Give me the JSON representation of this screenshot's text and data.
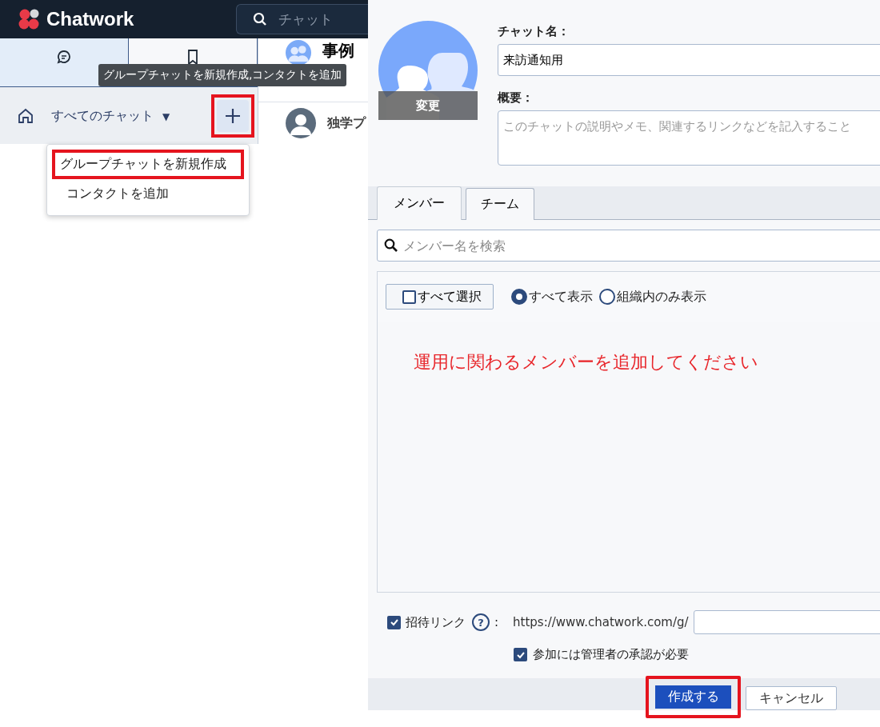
{
  "app_header": {
    "logo": "Chatwork",
    "search_placeholder": "チャット"
  },
  "sidebar": {
    "tabs": [
      {
        "kind": "chat",
        "selected": true
      },
      {
        "kind": "bookmark",
        "selected": false
      }
    ],
    "filter": {
      "label": "すべてのチャット",
      "caret": "▼"
    },
    "add_button": {
      "annotated": true
    }
  },
  "tooltip": "グループチャットを新規作成,コンタクトを追加",
  "add_menu": [
    {
      "label": "グループチャットを新規作成",
      "annotated": true
    },
    {
      "label": "コンタクトを追加",
      "annotated": false
    }
  ],
  "room_header": {
    "title": "事例"
  },
  "room_row": {
    "name": "独学プ"
  },
  "dialog": {
    "avatar_button": "変更",
    "name_label": "チャット名：",
    "name_value": "来訪通知用",
    "summary_label": "概要：",
    "summary_placeholder": "このチャットの説明やメモ、関連するリンクなどを記入すること",
    "tabs": [
      {
        "label": "メンバー",
        "selected": true
      },
      {
        "label": "チーム",
        "selected": false
      }
    ],
    "member_search_placeholder": "メンバー名を検索",
    "select_all": {
      "label": "すべて選択",
      "checked": false
    },
    "filters": [
      {
        "label": "すべて表示",
        "selected": true
      },
      {
        "label": "組織内のみ表示",
        "selected": false
      }
    ],
    "annotation": "運用に関わるメンバーを追加してください",
    "invite_link": {
      "label": "招待リンク",
      "checked": true,
      "help": "?",
      "colon": ":",
      "url_prefix": "https://www.chatwork.com/g/"
    },
    "approval": {
      "label": "参加には管理者の承認が必要",
      "checked": true
    },
    "buttons": [
      {
        "label": "作成する",
        "kind": "primary",
        "annotated": true
      },
      {
        "label": "キャンセル",
        "kind": "secondary",
        "annotated": false
      }
    ]
  }
}
